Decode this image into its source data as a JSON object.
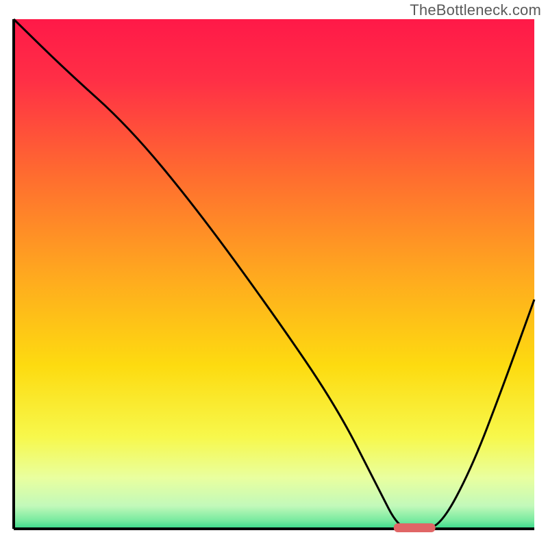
{
  "watermark": {
    "text": "TheBottleneck.com"
  },
  "chart_data": {
    "type": "line",
    "title": "",
    "xlabel": "",
    "ylabel": "",
    "xlim": [
      0,
      100
    ],
    "ylim": [
      0,
      100
    ],
    "grid": false,
    "series": [
      {
        "name": "bottleneck-curve",
        "x": [
          0,
          10,
          22,
          35,
          50,
          62,
          70,
          74,
          78,
          82,
          88,
          94,
          100
        ],
        "y": [
          100,
          90,
          79,
          63,
          42,
          24,
          8,
          0,
          0,
          0.5,
          12,
          28,
          45
        ]
      }
    ],
    "marker": {
      "name": "optimal-range",
      "x_center": 77,
      "y": 0,
      "width": 8,
      "color": "#e06666"
    },
    "background_gradient": {
      "stops": [
        {
          "offset": 0.0,
          "color": "#ff1948"
        },
        {
          "offset": 0.12,
          "color": "#ff2f46"
        },
        {
          "offset": 0.3,
          "color": "#ff6a30"
        },
        {
          "offset": 0.5,
          "color": "#ffa81f"
        },
        {
          "offset": 0.68,
          "color": "#fddb10"
        },
        {
          "offset": 0.82,
          "color": "#f7f84c"
        },
        {
          "offset": 0.9,
          "color": "#e9ff9f"
        },
        {
          "offset": 0.955,
          "color": "#c2f9ba"
        },
        {
          "offset": 0.985,
          "color": "#74e99e"
        },
        {
          "offset": 1.0,
          "color": "#36d989"
        }
      ]
    },
    "axis_color": "#000000",
    "line_color": "#000000",
    "line_width": 3
  }
}
